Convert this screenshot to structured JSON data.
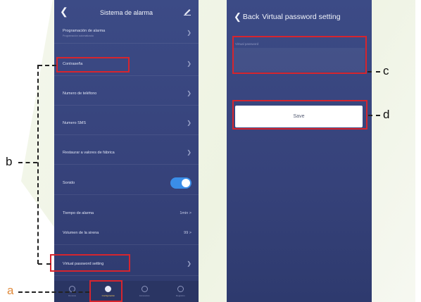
{
  "left_screen": {
    "title": "Sistema de alarma",
    "rows": [
      {
        "label": "Programación de alarma",
        "sub": "Programación automatizada"
      },
      {
        "label": "Contraseña"
      },
      {
        "label": "Numero de teléfono"
      },
      {
        "label": "Numero SMS"
      },
      {
        "label": "Restaurar a valores de fábrica"
      },
      {
        "label": "Sonido"
      },
      {
        "label": "Tiempo de alarma",
        "value": "1min >"
      },
      {
        "label": "Volumen de la sirena",
        "value": "99 >"
      },
      {
        "label": "Virtual password setting"
      }
    ],
    "tabs": [
      {
        "label": "Dominio"
      },
      {
        "label": "Configuración"
      },
      {
        "label": "Accesorios"
      },
      {
        "label": "Registros"
      }
    ]
  },
  "right_screen": {
    "back_label": "Back",
    "title": "Virtual password setting",
    "field_label": "Virtual password",
    "save_label": "Save"
  },
  "callouts": {
    "a": "a",
    "b": "b",
    "c": "c",
    "d": "d"
  },
  "colors": {
    "panel": "#3c4b86",
    "highlight": "#d6252e",
    "toggle": "#3a8de8",
    "active_tab": "#ffd35a"
  }
}
